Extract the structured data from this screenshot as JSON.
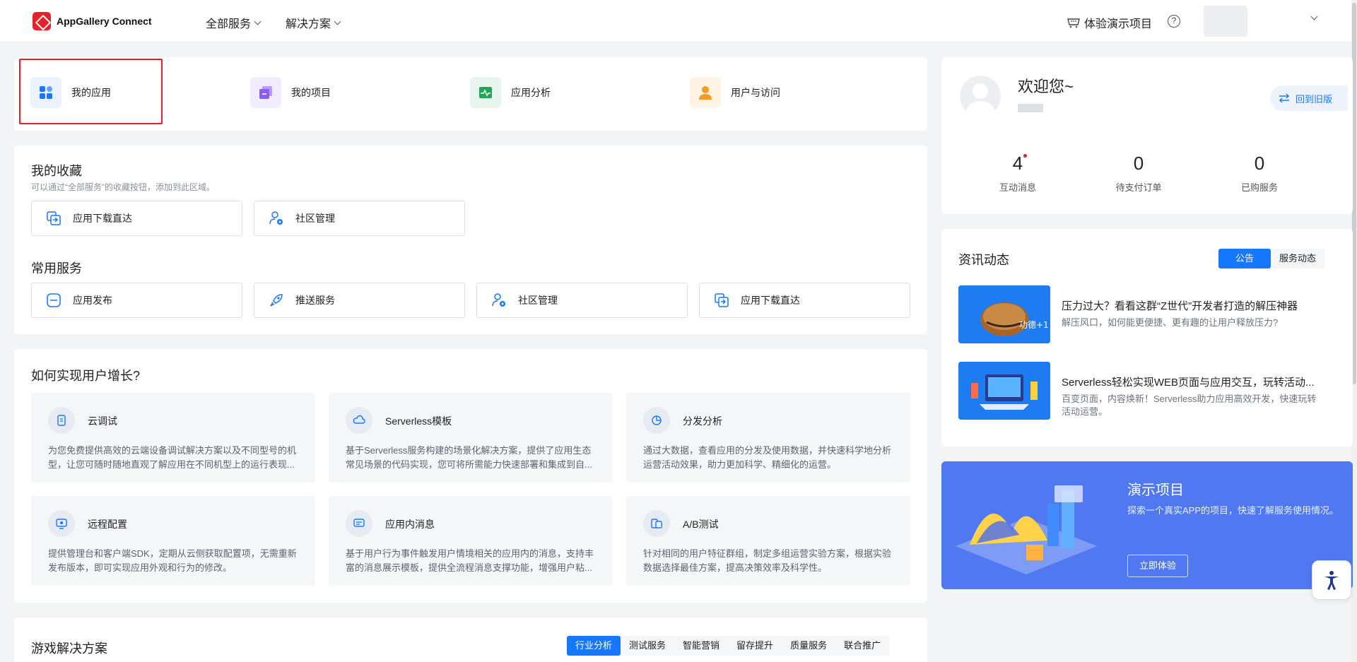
{
  "header": {
    "brand": "AppGallery Connect",
    "nav": [
      {
        "label": "全部服务"
      },
      {
        "label": "解决方案"
      }
    ],
    "demo_label": "体验演示项目",
    "help_glyph": "?"
  },
  "quick_access": [
    {
      "label": "我的应用",
      "icon": "apps-icon",
      "color": "#1677ff",
      "bg": "#eaf2ff"
    },
    {
      "label": "我的项目",
      "icon": "project-icon",
      "color": "#8b5cf6",
      "bg": "#f1ecff"
    },
    {
      "label": "应用分析",
      "icon": "analytics-icon",
      "color": "#22a559",
      "bg": "#e7f6ed"
    },
    {
      "label": "用户与访问",
      "icon": "user-access-icon",
      "color": "#f59a23",
      "bg": "#fff3e3"
    }
  ],
  "favorites": {
    "title": "我的收藏",
    "subtitle": "可以通过“全部服务”的收藏按钮，添加到此区域。",
    "items": [
      {
        "label": "应用下载直达",
        "icon": "download-direct-icon"
      },
      {
        "label": "社区管理",
        "icon": "community-icon"
      }
    ]
  },
  "common_services": {
    "title": "常用服务",
    "items": [
      {
        "label": "应用发布",
        "icon": "publish-icon"
      },
      {
        "label": "推送服务",
        "icon": "rocket-icon"
      },
      {
        "label": "社区管理",
        "icon": "community-icon"
      },
      {
        "label": "应用下载直达",
        "icon": "download-direct-icon"
      }
    ]
  },
  "growth": {
    "title": "如何实现用户增长?",
    "items": [
      {
        "title": "云调试",
        "icon": "cloud-debug-icon",
        "desc": "为您免费提供高效的云端设备调试解决方案以及不同型号的机型，让您可随时随地直观了解应用在不同机型上的运行表现..."
      },
      {
        "title": "Serverless模板",
        "icon": "serverless-icon",
        "desc": "基于Serverless服务构建的场景化解决方案，提供了应用生态常见场景的代码实现，您可将所需能力快速部署和集成到自..."
      },
      {
        "title": "分发分析",
        "icon": "distribution-icon",
        "desc": "通过大数据，查看应用的分发及使用数据，并快速科学地分析运营活动效果，助力更加科学、精细化的运营。"
      },
      {
        "title": "远程配置",
        "icon": "remote-config-icon",
        "desc": "提供管理台和客户端SDK，定期从云侧获取配置项，无需重新发布版本，即可实现应用外观和行为的修改。"
      },
      {
        "title": "应用内消息",
        "icon": "in-app-message-icon",
        "desc": "基于用户行为事件触发用户情境相关的应用内的消息，支持丰富的消息展示模板，提供全流程消息支撑功能，增强用户粘..."
      },
      {
        "title": "A/B测试",
        "icon": "ab-test-icon",
        "desc": "针对相同的用户特征群组，制定多组运营实验方案，根据实验数据选择最佳方案，提高决策效率及科学性。"
      }
    ]
  },
  "game_solutions": {
    "title": "游戏解决方案",
    "tabs": [
      "行业分析",
      "测试服务",
      "智能营销",
      "留存提升",
      "质量服务",
      "联合推广"
    ],
    "active_tab": 0
  },
  "profile": {
    "welcome": "欢迎您~",
    "back_old": "回到旧版",
    "stats": [
      {
        "value": "4",
        "label": "互动消息",
        "has_dot": true
      },
      {
        "value": "0",
        "label": "待支付订单",
        "has_dot": false
      },
      {
        "value": "0",
        "label": "已购服务",
        "has_dot": false
      }
    ]
  },
  "news": {
    "title": "资讯动态",
    "tabs": [
      "公告",
      "服务动态"
    ],
    "active_tab": 0,
    "items": [
      {
        "title": "压力过大？看看这群“Z世代”开发者打造的解压神器",
        "desc": "解压风口，如何能更便捷、更有趣的让用户释放压力?",
        "thumb_text": "功德+1"
      },
      {
        "title": "Serverless轻松实现WEB页面与应用交互，玩转活动...",
        "desc": "百变页面，内容焕新！Serverless助力应用高效开发，快速玩转活动运营。",
        "thumb_text": ""
      }
    ]
  },
  "demo_project": {
    "title": "演示项目",
    "desc": "探索一个真实APP的项目，快速了解服务使用情况。",
    "button": "立即体验"
  },
  "colors": {
    "primary": "#1677ff",
    "brand_red": "#e8202a",
    "demo_bg": "#5078f0"
  }
}
